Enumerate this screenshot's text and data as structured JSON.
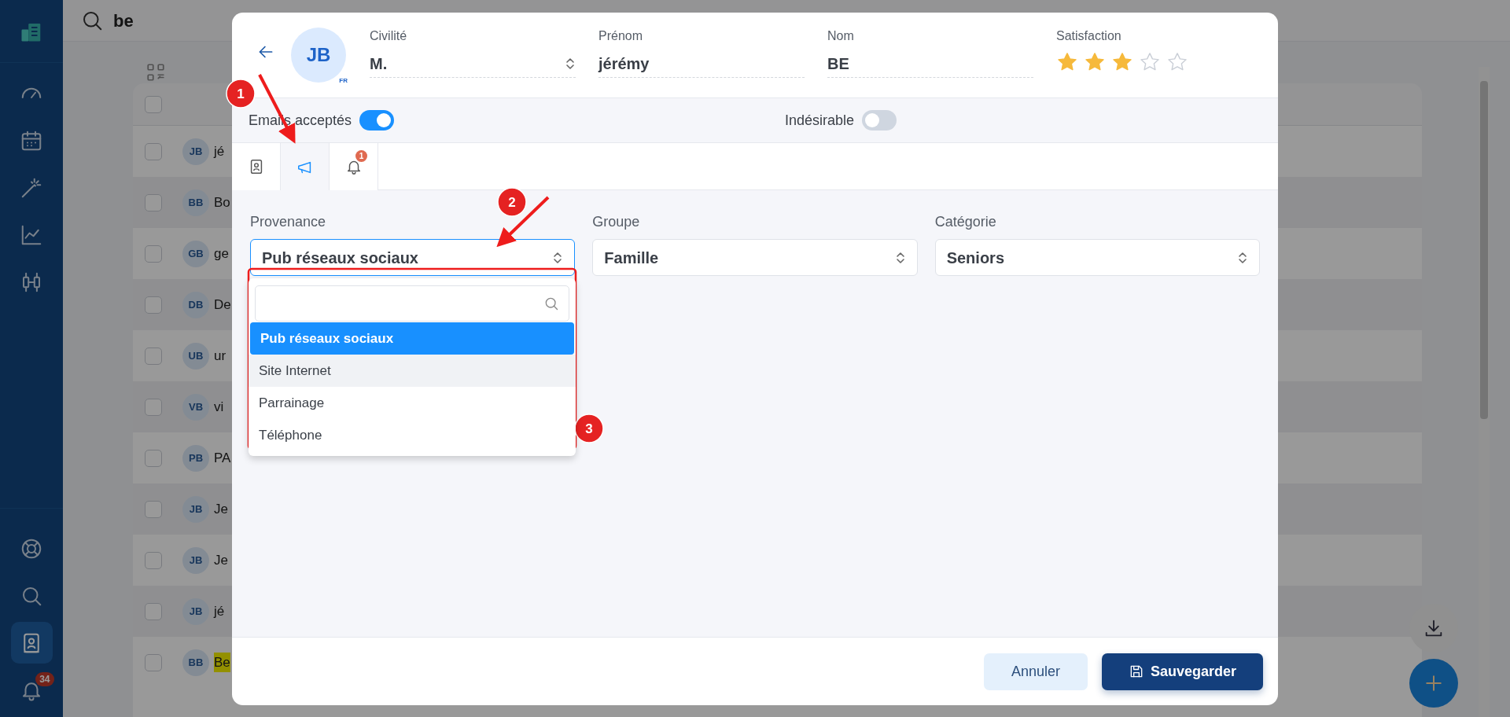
{
  "sidebar": {
    "nav": [
      {
        "kind": "dashboard",
        "selected": false
      },
      {
        "kind": "calendar",
        "selected": false
      },
      {
        "kind": "wand",
        "selected": false
      },
      {
        "kind": "chart",
        "selected": false
      },
      {
        "kind": "candles",
        "selected": false
      }
    ],
    "bottom": [
      {
        "kind": "help",
        "selected": false
      },
      {
        "kind": "search",
        "selected": false
      },
      {
        "kind": "contacts",
        "selected": true
      },
      {
        "kind": "notifications",
        "selected": false,
        "badge": "34"
      }
    ]
  },
  "search": {
    "value": "be"
  },
  "list": {
    "header_checked": false,
    "rows": [
      {
        "initials": "JB",
        "name": "jé",
        "checked": false,
        "highlighted": false
      },
      {
        "initials": "BB",
        "name": "Bo",
        "checked": false,
        "highlighted": false
      },
      {
        "initials": "GB",
        "name": "ge",
        "checked": false,
        "highlighted": false
      },
      {
        "initials": "DB",
        "name": "De",
        "checked": false,
        "highlighted": false
      },
      {
        "initials": "UB",
        "name": "ur",
        "checked": false,
        "highlighted": false
      },
      {
        "initials": "VB",
        "name": "vi",
        "checked": false,
        "highlighted": false
      },
      {
        "initials": "PB",
        "name": "PA",
        "checked": false,
        "highlighted": false
      },
      {
        "initials": "JB",
        "name": "Je",
        "checked": false,
        "highlighted": false
      },
      {
        "initials": "JB",
        "name": "Je",
        "checked": false,
        "highlighted": false
      },
      {
        "initials": "JB",
        "name": "jé",
        "checked": false,
        "highlighted": false
      },
      {
        "initials": "BB",
        "name": "Be",
        "checked": false,
        "highlighted": true
      }
    ]
  },
  "modal": {
    "avatar": {
      "initials": "JB",
      "locale": "FR"
    },
    "fields": [
      {
        "kind": "select",
        "label": "Civilité",
        "value": "M."
      },
      {
        "kind": "text",
        "label": "Prénom",
        "value": "jérémy"
      },
      {
        "kind": "text",
        "label": "Nom",
        "value": "BE"
      }
    ],
    "satisfaction": {
      "label": "Satisfaction",
      "stars": 3
    },
    "toggles": [
      {
        "label": "Emails acceptés",
        "on": true
      },
      {
        "label": "Indésirable",
        "on": false
      }
    ],
    "tabs": [
      {
        "kind": "contact",
        "selected": false
      },
      {
        "kind": "campaign",
        "selected": true
      },
      {
        "kind": "notifications",
        "selected": false,
        "badge": "1"
      }
    ],
    "selects": [
      {
        "label": "Provenance",
        "value": "Pub réseaux sociaux",
        "open": true,
        "options": [
          {
            "label": "Pub réseaux sociaux",
            "selected": true,
            "highlighted": false
          },
          {
            "label": "Site Internet",
            "selected": false,
            "highlighted": true
          },
          {
            "label": "Parrainage",
            "selected": false,
            "highlighted": false
          },
          {
            "label": "Téléphone",
            "selected": false,
            "highlighted": false
          }
        ]
      },
      {
        "label": "Groupe",
        "value": "Famille",
        "open": false
      },
      {
        "label": "Catégorie",
        "value": "Seniors",
        "open": false
      }
    ],
    "buttons": [
      {
        "kind": "cancel",
        "label": "Annuler"
      },
      {
        "kind": "save",
        "label": "Sauvegarder"
      }
    ]
  },
  "annotations": [
    {
      "label": "1"
    },
    {
      "label": "2"
    },
    {
      "label": "3"
    }
  ]
}
